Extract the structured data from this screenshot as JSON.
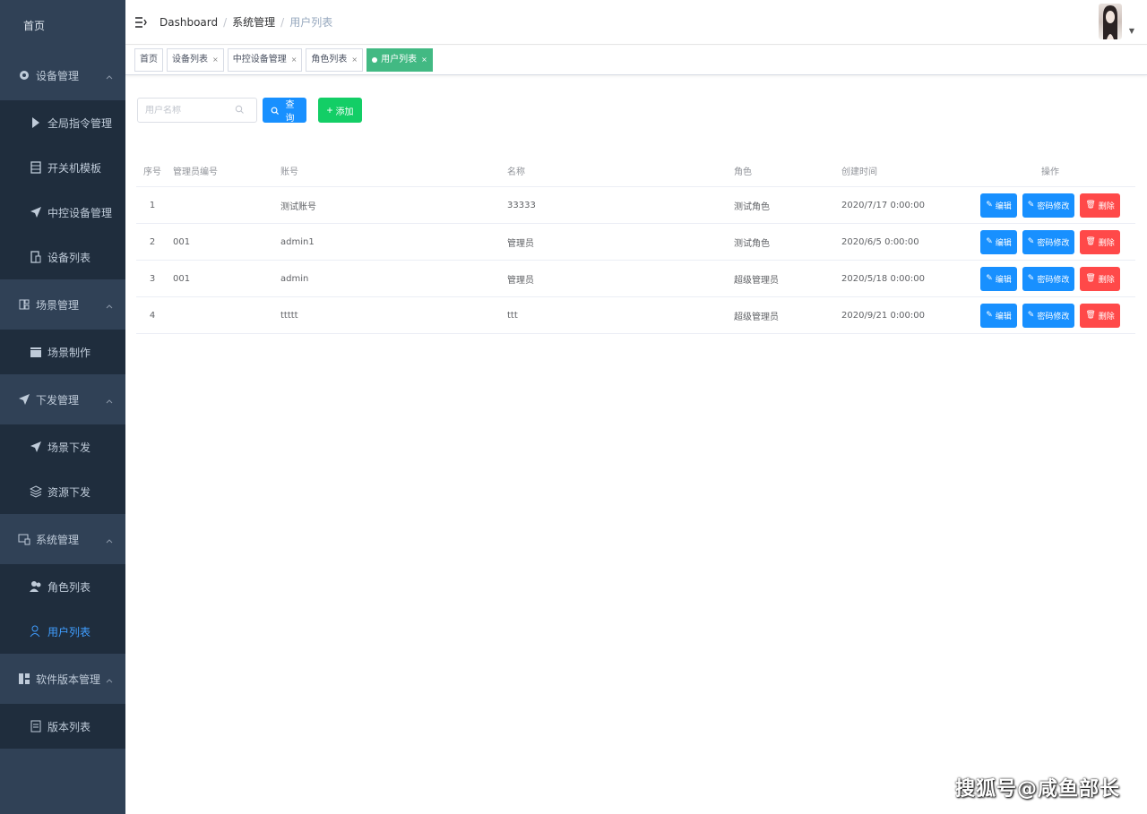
{
  "sidebar": {
    "home": "首页",
    "groups": [
      {
        "label": "设备管理",
        "icon": "gear-icon",
        "items": [
          {
            "label": "全局指令管理",
            "icon": "flag-icon"
          },
          {
            "label": "开关机模板",
            "icon": "server-icon"
          },
          {
            "label": "中控设备管理",
            "icon": "send-icon"
          },
          {
            "label": "设备列表",
            "icon": "device-icon"
          }
        ]
      },
      {
        "label": "场景管理",
        "icon": "scene-icon",
        "items": [
          {
            "label": "场景制作",
            "icon": "clapper-icon"
          }
        ]
      },
      {
        "label": "下发管理",
        "icon": "send-icon",
        "items": [
          {
            "label": "场景下发",
            "icon": "send-icon"
          },
          {
            "label": "资源下发",
            "icon": "layers-icon"
          }
        ]
      },
      {
        "label": "系统管理",
        "icon": "monitor-icon",
        "items": [
          {
            "label": "角色列表",
            "icon": "users-icon"
          },
          {
            "label": "用户列表",
            "icon": "user-icon",
            "active": true
          }
        ]
      },
      {
        "label": "软件版本管理",
        "icon": "apps-icon",
        "items": [
          {
            "label": "版本列表",
            "icon": "doc-icon"
          }
        ]
      }
    ]
  },
  "header": {
    "breadcrumb": [
      "Dashboard",
      "系统管理",
      "用户列表"
    ],
    "separator": "/"
  },
  "tags": [
    {
      "label": "首页",
      "closable": false
    },
    {
      "label": "设备列表",
      "closable": true
    },
    {
      "label": "中控设备管理",
      "closable": true
    },
    {
      "label": "角色列表",
      "closable": true
    },
    {
      "label": "用户列表",
      "closable": true,
      "active": true
    }
  ],
  "filter": {
    "search_placeholder": "用户名称",
    "query_label": "查询",
    "add_label": "添加"
  },
  "table": {
    "headers": [
      "序号",
      "管理员编号",
      "账号",
      "名称",
      "角色",
      "创建时间",
      "操作"
    ],
    "rows": [
      [
        "1",
        "",
        "测试账号",
        "33333",
        "测试角色",
        "2020/7/17 0:00:00"
      ],
      [
        "2",
        "001",
        "admin1",
        "管理员",
        "测试角色",
        "2020/6/5 0:00:00"
      ],
      [
        "3",
        "001",
        "admin",
        "管理员",
        "超级管理员",
        "2020/5/18 0:00:00"
      ],
      [
        "4",
        "",
        "ttttt",
        "ttt",
        "超级管理员",
        "2020/9/21 0:00:00"
      ]
    ],
    "actions": {
      "edit": "编辑",
      "password": "密码修改",
      "delete": "删除"
    }
  },
  "close_glyph": "×",
  "watermark": "搜狐号@咸鱼部长",
  "colors": {
    "sidebar_bg": "#304156",
    "submenu_bg": "#1f2d3d",
    "primary": "#1890ff",
    "success": "#13ce66",
    "danger": "#ff4949",
    "tag_active": "#42b983"
  }
}
